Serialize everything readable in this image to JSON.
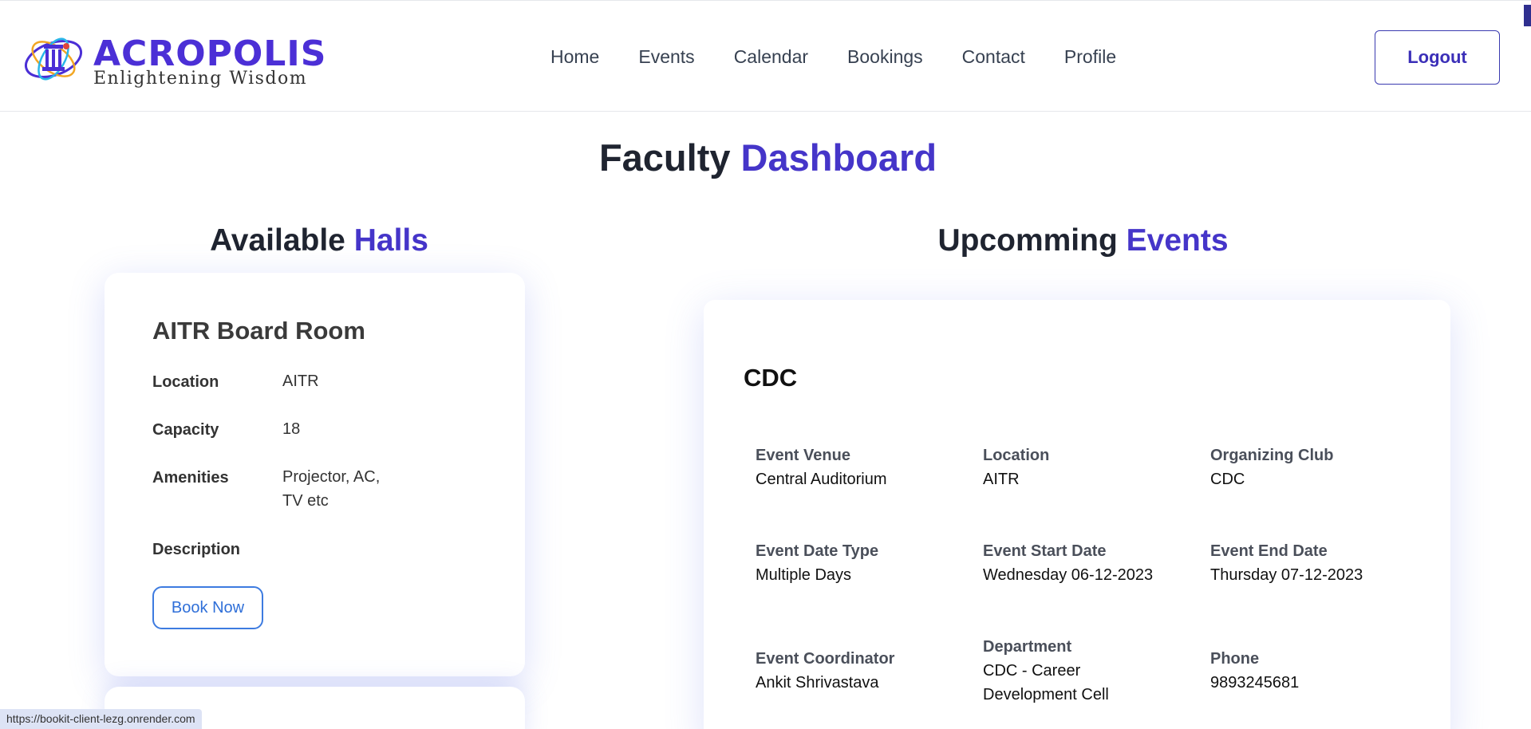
{
  "header": {
    "logo_word": "ACROPOLIS",
    "logo_tagline": "Enlightening Wisdom",
    "nav": [
      {
        "label": "Home"
      },
      {
        "label": "Events"
      },
      {
        "label": "Calendar"
      },
      {
        "label": "Bookings"
      },
      {
        "label": "Contact"
      },
      {
        "label": "Profile"
      }
    ],
    "logout_label": "Logout"
  },
  "page_title": {
    "part1": "Faculty",
    "part2": "Dashboard"
  },
  "halls": {
    "title_part1": "Available",
    "title_part2": "Halls",
    "items": [
      {
        "name": "AITR Board Room",
        "location_label": "Location",
        "location": "AITR",
        "capacity_label": "Capacity",
        "capacity": "18",
        "amenities_label": "Amenities",
        "amenities": "Projector, AC, TV etc",
        "description_label": "Description",
        "description": "",
        "book_label": "Book Now"
      }
    ]
  },
  "events": {
    "title_part1": "Upcomming",
    "title_part2": "Events",
    "items": [
      {
        "name": "CDC",
        "fields": [
          {
            "label": "Event Venue",
            "value": "Central Auditorium"
          },
          {
            "label": "Location",
            "value": "AITR"
          },
          {
            "label": "Organizing Club",
            "value": "CDC"
          },
          {
            "label": "Event Date Type",
            "value": "Multiple Days"
          },
          {
            "label": "Event Start Date",
            "value": "Wednesday 06-12-2023"
          },
          {
            "label": "Event End Date",
            "value": "Thursday 07-12-2023"
          },
          {
            "label": "Event Coordinator",
            "value": "Ankit Shrivastava"
          },
          {
            "label": "Department",
            "value": "CDC - Career Development Cell"
          },
          {
            "label": "Phone",
            "value": "9893245681"
          }
        ]
      }
    ]
  },
  "status_bar": {
    "url": "https://bookit-client-lezg.onrender.com"
  },
  "colors": {
    "accent": "#4535c9",
    "book_button": "#3d7be0",
    "logo": "#4b2fd6"
  }
}
